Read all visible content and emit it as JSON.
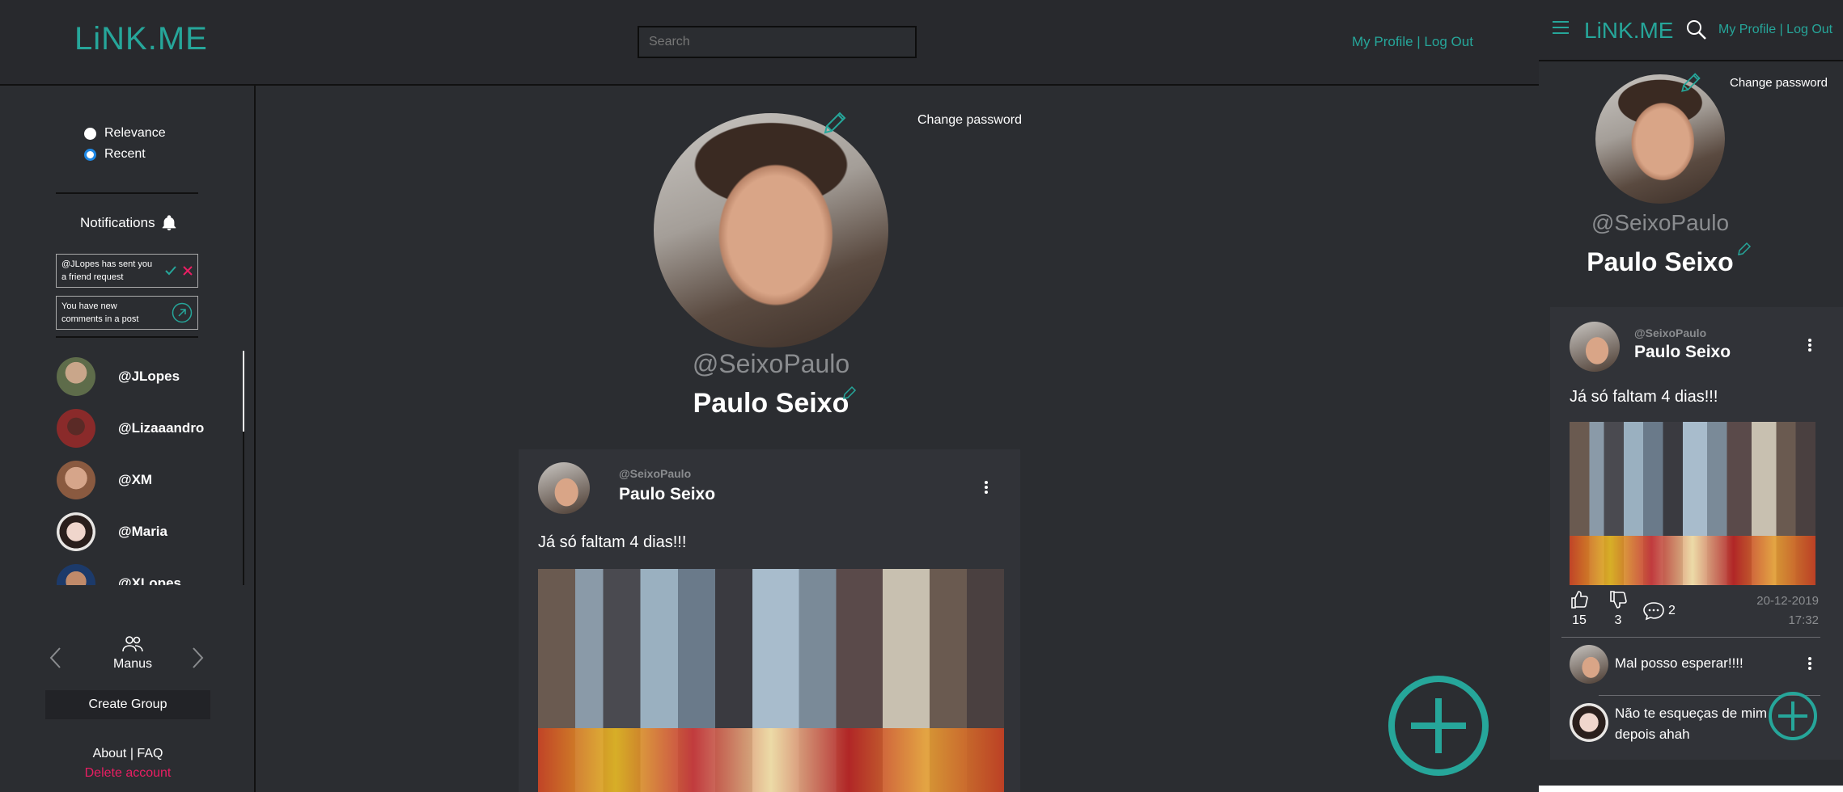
{
  "app": {
    "logo": "LiNK.ME",
    "accent": "#26a69a",
    "danger": "#e91e63"
  },
  "header": {
    "search_placeholder": "Search",
    "links": "My Profile | Log Out"
  },
  "sort": {
    "options": [
      "Relevance",
      "Recent"
    ],
    "selected": "Recent"
  },
  "notifications": {
    "title": "Notifications",
    "items": [
      {
        "text": "@JLopes has sent you a friend request"
      },
      {
        "text": "You have new comments in a post"
      }
    ]
  },
  "friends": [
    "@JLopes",
    "@Lizaaandro",
    "@XM",
    "@Maria",
    "@XLopes"
  ],
  "groups": {
    "current": "Manus",
    "create_label": "Create Group"
  },
  "footer": {
    "about": "About | FAQ",
    "delete": "Delete account"
  },
  "profile": {
    "change_password": "Change password",
    "handle": "@SeixoPaulo",
    "name": "Paulo Seixo"
  },
  "post": {
    "handle": "@SeixoPaulo",
    "name": "Paulo Seixo",
    "text": "Já só faltam 4 dias!!!",
    "likes": "15",
    "dislikes": "3",
    "comments": "2",
    "date": "20-12-2019",
    "time": "17:32"
  },
  "comments": [
    {
      "text": "Mal posso esperar!!!!"
    },
    {
      "text": "Não te esqueças de mim depois ahah"
    }
  ]
}
